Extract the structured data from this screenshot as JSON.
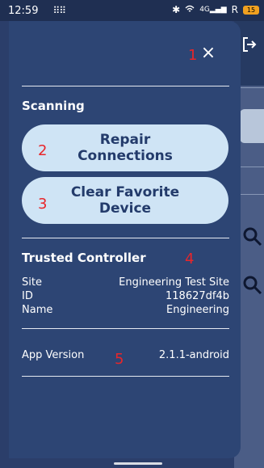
{
  "status_bar": {
    "time": "12:59",
    "grid_icon": "⠿⠿",
    "signal_text": "4G",
    "carrier_badge": "R",
    "battery": "15"
  },
  "drawer": {
    "close_label": "×",
    "scanning": {
      "title": "Scanning",
      "repair_label": "Repair\nConnections",
      "clear_label": "Clear Favorite\nDevice"
    },
    "trusted_controller": {
      "title": "Trusted Controller",
      "rows": [
        {
          "label": "Site",
          "value": "Engineering Test Site"
        },
        {
          "label": "ID",
          "value": "118627df4b"
        },
        {
          "label": "Name",
          "value": "Engineering"
        }
      ]
    },
    "app_version": {
      "label": "App Version",
      "value": "2.1.1-android"
    }
  },
  "markers": [
    "1",
    "2",
    "3",
    "4",
    "5"
  ],
  "colors": {
    "drawer_bg": "#2d4574",
    "pill_bg": "#cfe4f5",
    "pill_text": "#233b6b",
    "marker": "#e8262a"
  }
}
